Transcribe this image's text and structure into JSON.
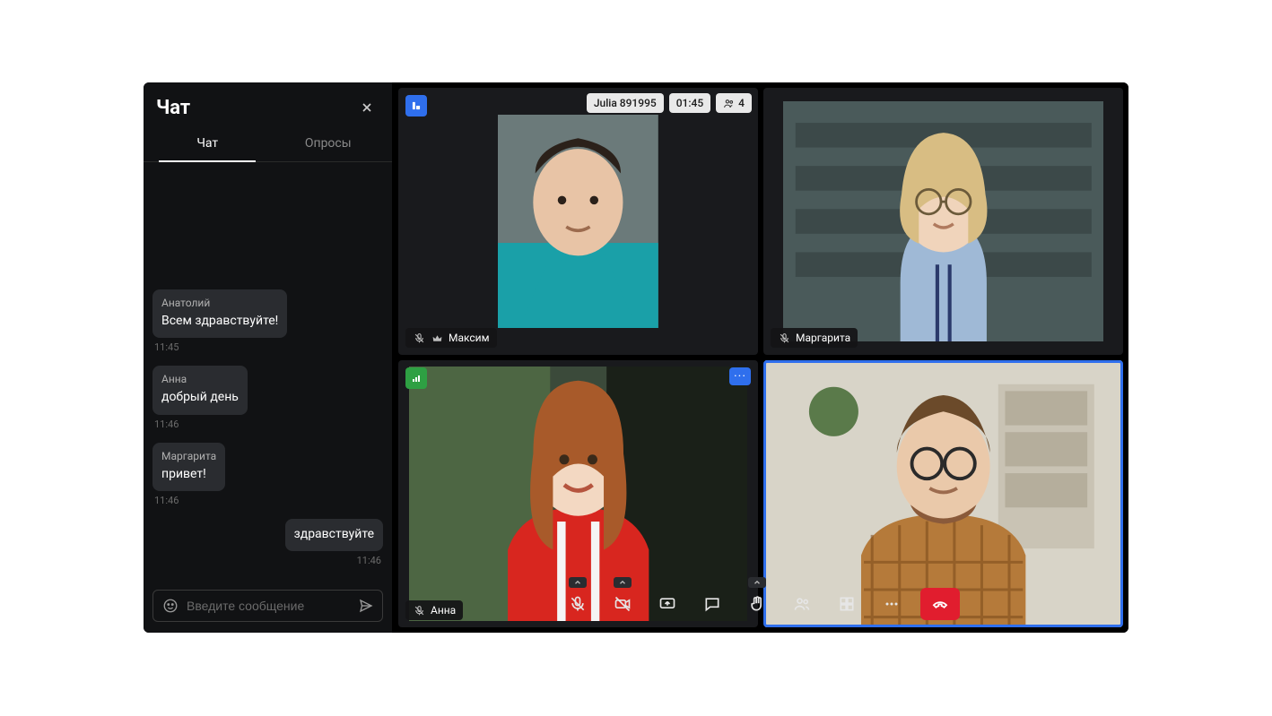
{
  "chat": {
    "title": "Чат",
    "tabs": {
      "chat": "Чат",
      "polls": "Опросы"
    },
    "messages": [
      {
        "author": "Анатолий",
        "text": "Всем здравствуйте!",
        "time": "11:45",
        "mine": false
      },
      {
        "author": "Анна",
        "text": "добрый день",
        "time": "11:46",
        "mine": false
      },
      {
        "author": "Маргарита",
        "text": "привет!",
        "time": "11:46",
        "mine": false
      },
      {
        "author": "",
        "text": "здравствуйте",
        "time": "11:46",
        "mine": true
      }
    ],
    "input_placeholder": "Введите сообщение"
  },
  "call": {
    "room_label": "Julia 891995",
    "timer": "01:45",
    "participants_count": "4",
    "tiles": [
      {
        "name": "Максим",
        "muted": true,
        "host": true,
        "badge": "logo"
      },
      {
        "name": "Маргарита",
        "muted": true
      },
      {
        "name": "Анна",
        "muted": true,
        "badge": "signal",
        "has_more": true
      },
      {
        "name": "",
        "active": true
      }
    ]
  },
  "icons": {
    "close": "close-icon",
    "emoji": "emoji-icon",
    "send": "send-icon",
    "mic_off": "mic-off-icon",
    "cam_off": "camera-off-icon",
    "share": "share-screen-icon",
    "chat": "chat-bubble-icon",
    "raise_hand": "raise-hand-icon",
    "people": "participants-icon",
    "grid": "grid-layout-icon",
    "more": "more-options-icon",
    "hangup": "hangup-icon",
    "crown": "host-crown-icon",
    "signal": "signal-icon"
  }
}
